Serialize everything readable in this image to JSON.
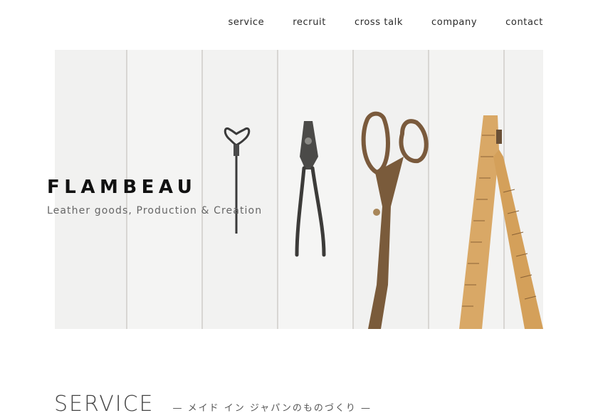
{
  "nav": {
    "items": [
      "service",
      "recruit",
      "cross talk",
      "company",
      "contact"
    ]
  },
  "hero": {
    "title": "FLAMBEAU",
    "subtitle": "Leather goods, Production & Creation",
    "image_subject": "tools on white wooden planks"
  },
  "section": {
    "title": "SERVICE",
    "subtitle": "— メイド イン ジャパンのものづくり —"
  },
  "colors": {
    "background": "#ffffff",
    "text": "#222222",
    "subtitle": "#666666"
  },
  "icons": [
    "awl-icon",
    "pliers-icon",
    "scissors-icon",
    "folding-ruler-icon"
  ]
}
